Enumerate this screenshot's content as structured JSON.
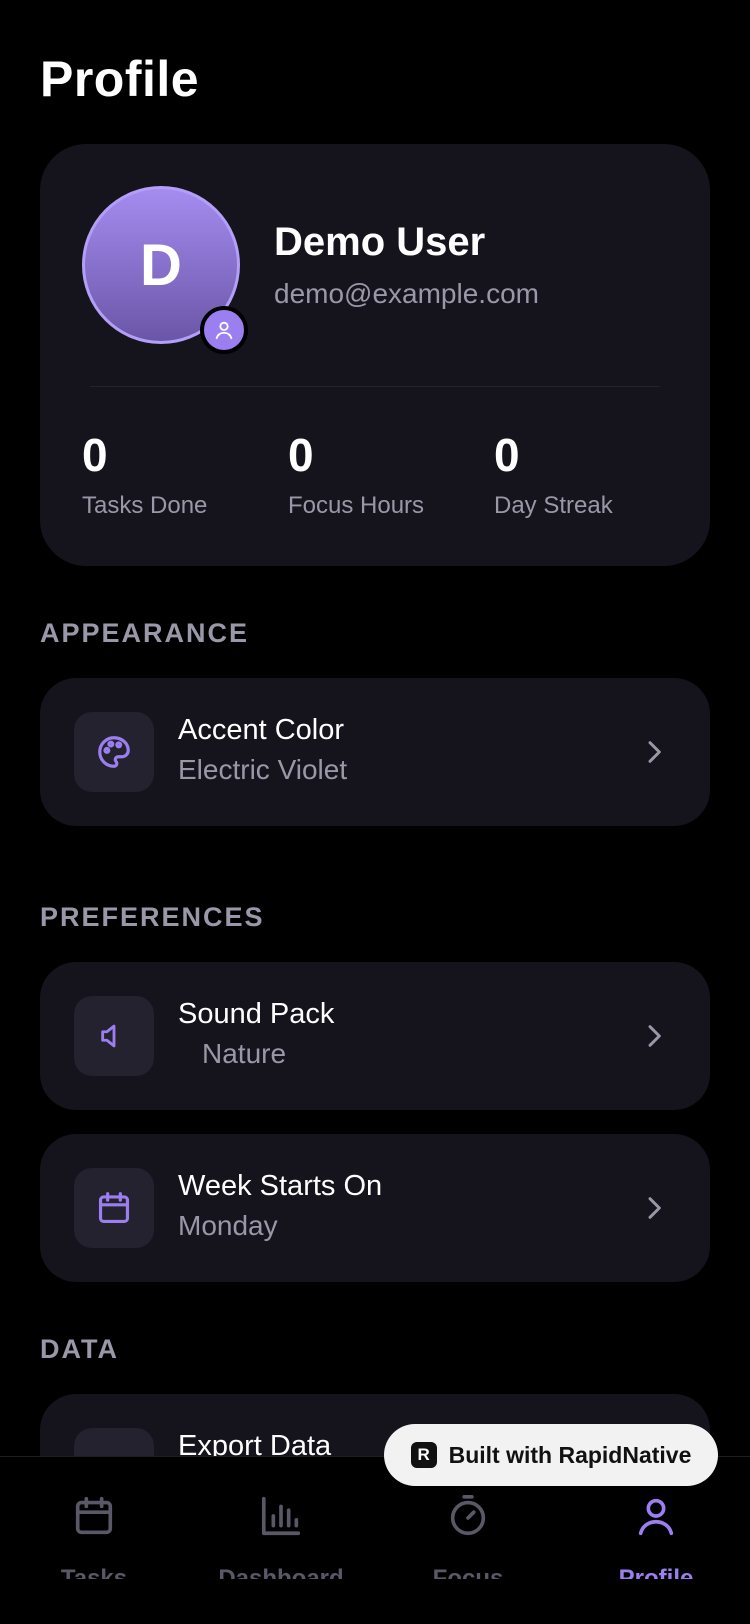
{
  "header": {
    "title": "Profile"
  },
  "profile": {
    "initial": "D",
    "name": "Demo User",
    "email": "demo@example.com",
    "stats": [
      {
        "value": "0",
        "label": "Tasks Done"
      },
      {
        "value": "0",
        "label": "Focus Hours"
      },
      {
        "value": "0",
        "label": "Day Streak"
      }
    ]
  },
  "sections": {
    "appearance": "APPEARANCE",
    "preferences": "PREFERENCES",
    "data": "DATA"
  },
  "settings": {
    "accent": {
      "label": "Accent Color",
      "value": "Electric Violet",
      "icon": "palette-icon"
    },
    "sound": {
      "label": "Sound Pack",
      "value": "Nature",
      "icon": "speaker-icon"
    },
    "week": {
      "label": "Week Starts On",
      "value": "Monday",
      "icon": "calendar-icon"
    },
    "export": {
      "label": "Export Data"
    }
  },
  "tabs": [
    {
      "label": "Tasks",
      "icon": "calendar-icon"
    },
    {
      "label": "Dashboard",
      "icon": "bar-chart-icon"
    },
    {
      "label": "Focus",
      "icon": "timer-icon"
    },
    {
      "label": "Profile",
      "icon": "user-icon",
      "active": true
    }
  ],
  "badge": {
    "logo": "R",
    "text": "Built with RapidNative"
  },
  "colors": {
    "accent": "#9b7ff0",
    "card": "#15141c",
    "background": "#000000",
    "muted": "#9a98a8"
  }
}
